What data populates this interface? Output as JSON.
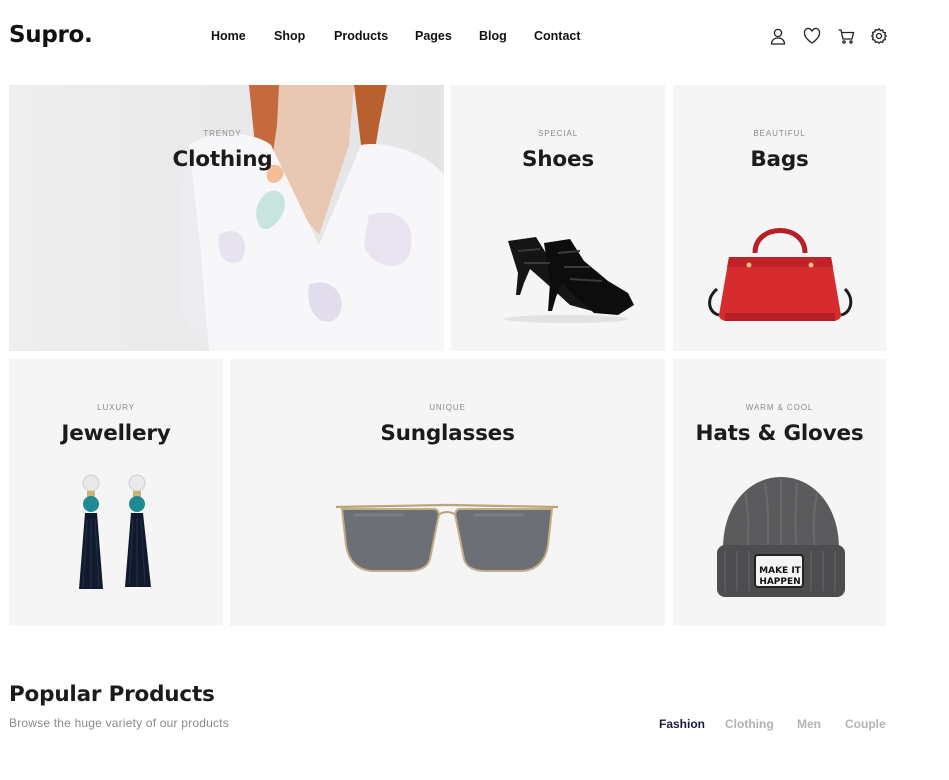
{
  "brand": {
    "logo": "Supro."
  },
  "nav": {
    "items": [
      "Home",
      "Shop",
      "Products",
      "Pages",
      "Blog",
      "Contact"
    ]
  },
  "header_icons": [
    "user-icon",
    "heart-icon",
    "cart-icon",
    "settings-icon"
  ],
  "categories": [
    {
      "subtitle": "TRENDY",
      "title": "Clothing"
    },
    {
      "subtitle": "SPECIAL",
      "title": "Shoes"
    },
    {
      "subtitle": "BEAUTIFUL",
      "title": "Bags"
    },
    {
      "subtitle": "LUXURY",
      "title": "Jewellery"
    },
    {
      "subtitle": "UNIQUE",
      "title": "Sunglasses"
    },
    {
      "subtitle": "WARM & COOL",
      "title": "Hats & Gloves"
    }
  ],
  "hat_patch": {
    "line1": "MAKE IT",
    "line2": "HAPPEN"
  },
  "popular": {
    "title": "Popular Products",
    "subtitle": "Browse the huge variety of our products",
    "filters": [
      "Fashion",
      "Clothing",
      "Men",
      "Couple"
    ],
    "active_filter": "Fashion"
  },
  "colors": {
    "tile_bg": "#f5f5f5",
    "text_dark": "#1b1b1b",
    "text_muted": "#8a8a8a",
    "filter_inactive": "#b3b3b3",
    "bag_red": "#d62b2f"
  }
}
